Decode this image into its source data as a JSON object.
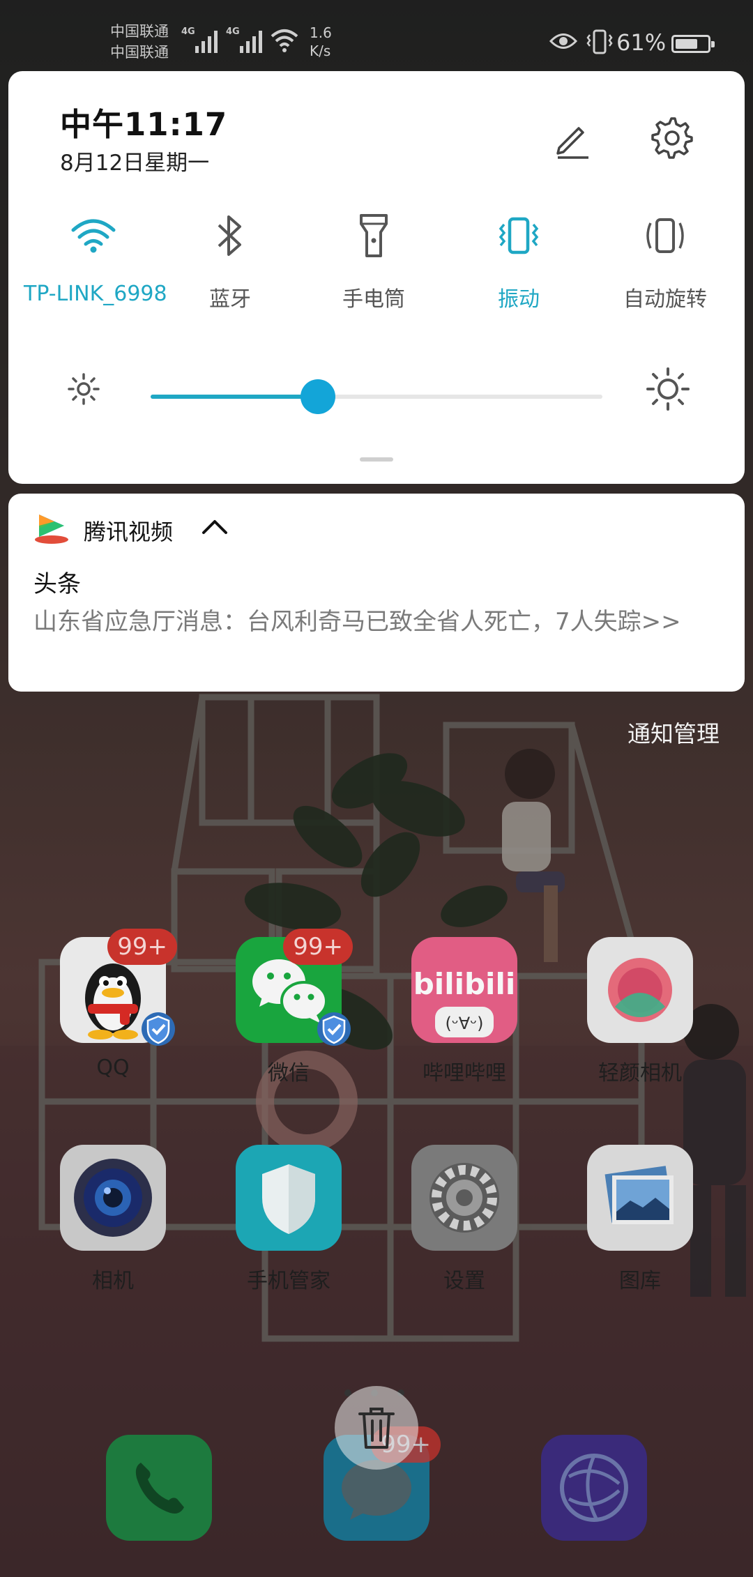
{
  "status_bar": {
    "carrier_1": "中国联通",
    "carrier_2": "中国联通",
    "network_1": "4G",
    "network_2": "4G",
    "speed_value": "1.6",
    "speed_unit": "K/s",
    "battery_text": "61%",
    "battery_level": 0.61
  },
  "quick_settings": {
    "time": "中午11:17",
    "date": "8月12日星期一",
    "tiles": [
      {
        "label": "TP-LINK_6998",
        "icon": "wifi-icon",
        "active": true
      },
      {
        "label": "蓝牙",
        "icon": "bluetooth-icon",
        "active": false
      },
      {
        "label": "手电筒",
        "icon": "flashlight-icon",
        "active": false
      },
      {
        "label": "振动",
        "icon": "vibrate-icon",
        "active": true
      },
      {
        "label": "自动旋转",
        "icon": "auto-rotate-icon",
        "active": false
      }
    ],
    "brightness_level": 0.37,
    "accent_color": "#1fa7c4"
  },
  "notification": {
    "app_name": "腾讯视频",
    "title": "头条",
    "body": "山东省应急厅消息：台风利奇马已致全省人死亡，7人失踪>>"
  },
  "notification_manage": "通知管理",
  "home": {
    "apps_row1": [
      {
        "name": "QQ",
        "badge": "99+",
        "icon": "qq-icon"
      },
      {
        "name": "微信",
        "badge": "99+",
        "icon": "wechat-icon"
      },
      {
        "name": "哔哩哔哩",
        "badge": "",
        "icon": "bilibili-icon"
      },
      {
        "name": "轻颜相机",
        "badge": "",
        "icon": "camera-beauty-icon"
      }
    ],
    "apps_row2": [
      {
        "name": "相机",
        "icon": "camera-icon"
      },
      {
        "name": "手机管家",
        "icon": "phone-manager-icon"
      },
      {
        "name": "设置",
        "icon": "settings-icon"
      },
      {
        "name": "图库",
        "icon": "gallery-icon"
      }
    ],
    "dock_badge": "99+"
  }
}
